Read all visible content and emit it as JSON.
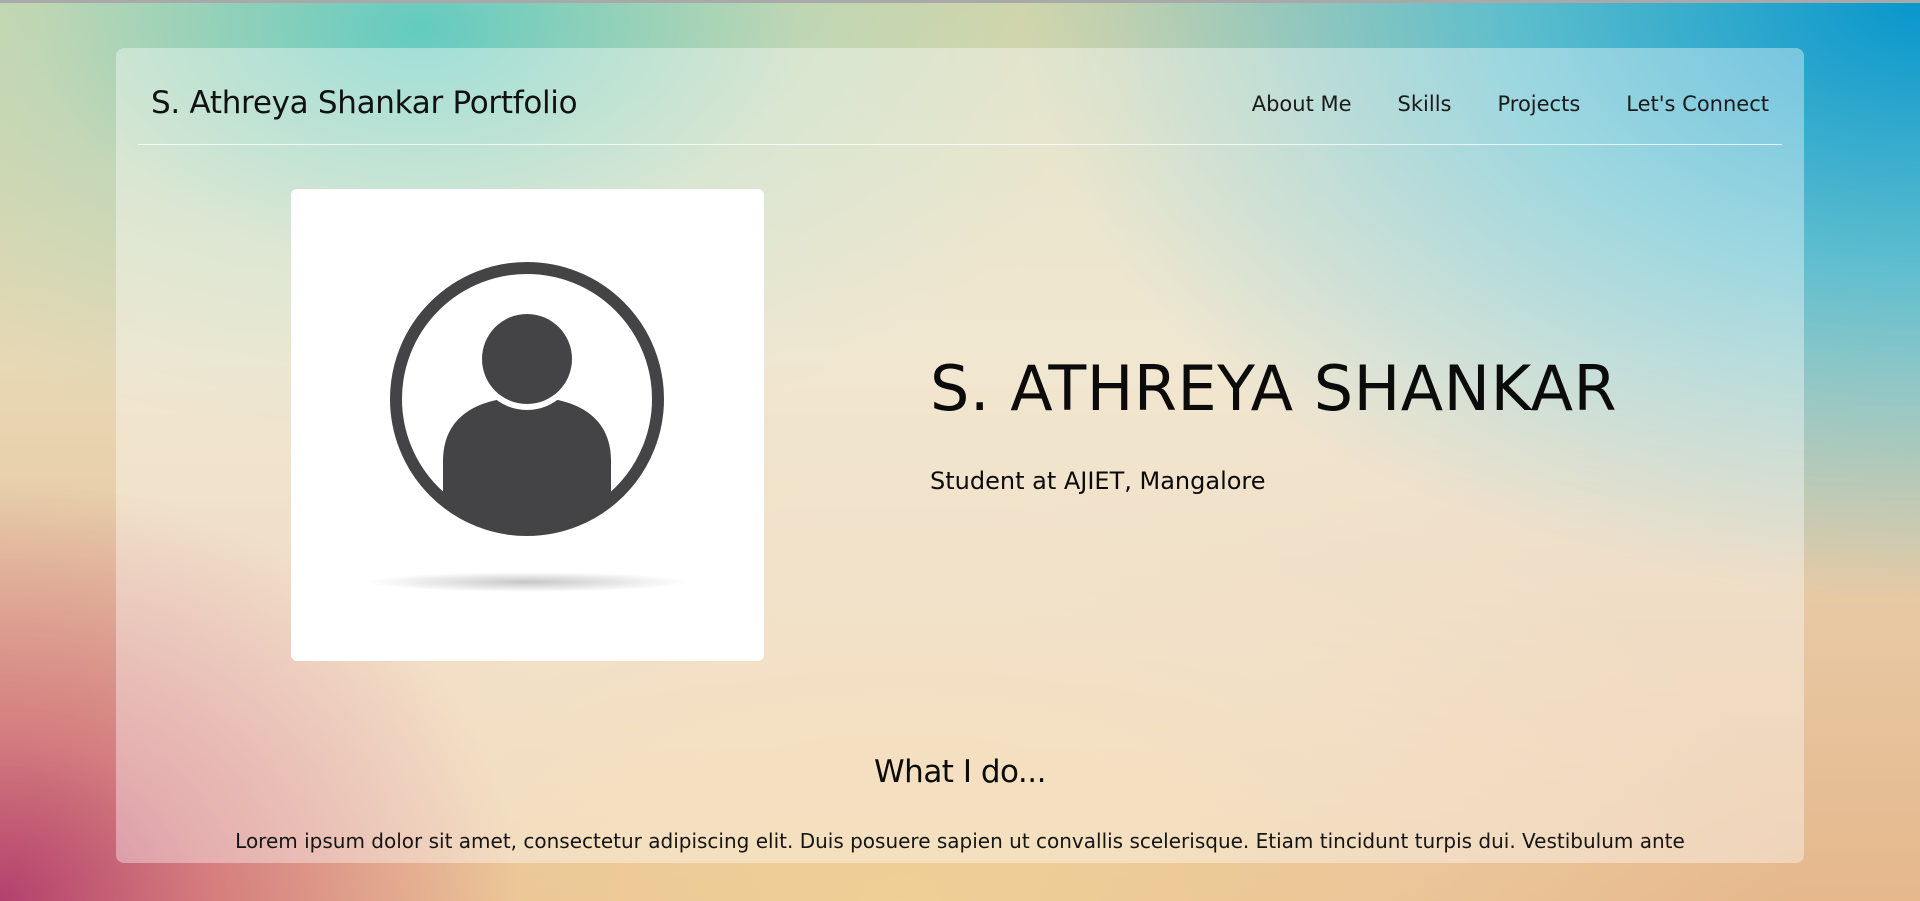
{
  "header": {
    "brand": "S. Athreya Shankar Portfolio",
    "nav": [
      {
        "label": "About Me"
      },
      {
        "label": "Skills"
      },
      {
        "label": "Projects"
      },
      {
        "label": "Let's Connect"
      }
    ]
  },
  "hero": {
    "photo_icon": "user-avatar-icon",
    "name": "S. ATHREYA SHANKAR",
    "role": "Student at AJIET, Mangalore"
  },
  "what_i_do": {
    "title": "What I do...",
    "text": "Lorem ipsum dolor sit amet, consectetur adipiscing elit. Duis posuere sapien ut convallis scelerisque. Etiam tincidunt turpis dui. Vestibulum ante"
  },
  "colors": {
    "card_overlay": "rgba(255,255,255,0.38)",
    "avatar_icon": "#444446",
    "text": "#0b0b0b"
  }
}
